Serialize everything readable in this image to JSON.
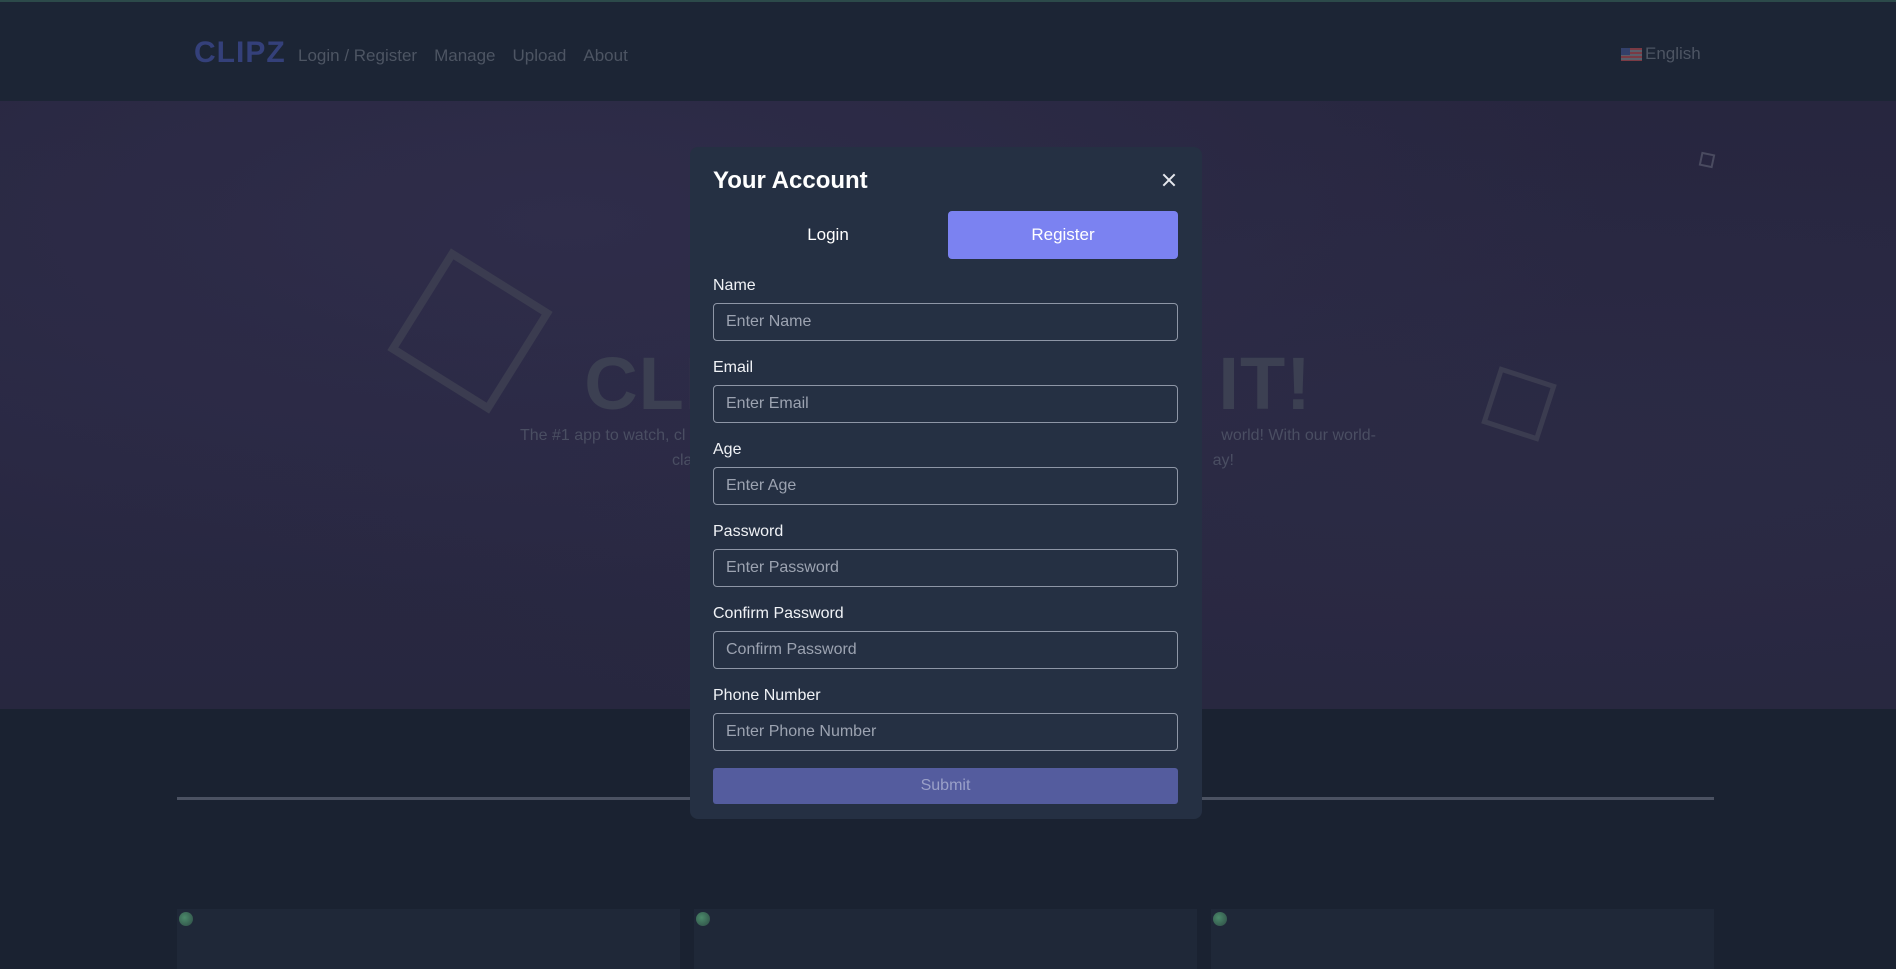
{
  "nav": {
    "logo": "CLIPZ",
    "links": [
      "Login / Register",
      "Manage",
      "Upload",
      "About"
    ],
    "language": "English"
  },
  "hero": {
    "title_left": "CLI",
    "title_right": "IT!",
    "subtitle_left_1": "The #1 app to watch, cl",
    "subtitle_right_1": "world! With our world-",
    "subtitle_left_2": "cla",
    "subtitle_right_2": "ay!"
  },
  "modal": {
    "title": "Your Account",
    "tabs": [
      {
        "label": "Login",
        "active": false
      },
      {
        "label": "Register",
        "active": true
      }
    ],
    "fields": [
      {
        "label": "Name",
        "placeholder": "Enter Name",
        "value": ""
      },
      {
        "label": "Email",
        "placeholder": "Enter Email",
        "value": ""
      },
      {
        "label": "Age",
        "placeholder": "Enter Age",
        "value": ""
      },
      {
        "label": "Password",
        "placeholder": "Enter Password",
        "value": ""
      },
      {
        "label": "Confirm Password",
        "placeholder": "Confirm Password",
        "value": ""
      },
      {
        "label": "Phone Number",
        "placeholder": "Enter Phone Number",
        "value": ""
      }
    ],
    "submit_label": "Submit"
  },
  "icons": {
    "close": "close-icon",
    "flag": "us-flag-icon",
    "card_image": "broken-image-icon"
  },
  "colors": {
    "accent": "#7b82f1",
    "submit_disabled": "#545c9e",
    "modal_bg": "#253043",
    "page_bg": "#1a2231"
  }
}
